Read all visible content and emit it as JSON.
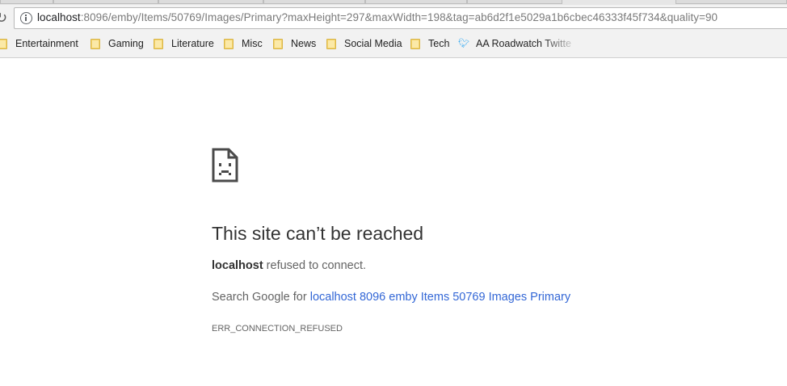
{
  "browser": {
    "url_host": "localhost",
    "url_rest": ":8096/emby/Items/50769/Images/Primary?maxHeight=297&maxWidth=198&tag=ab6d2f1e5029a1b6cbec46333f45f734&quality=90",
    "icons": {
      "reload": "reload-icon",
      "site_info": "info-icon",
      "folder": "folder-icon",
      "twitter": "twitter-icon"
    }
  },
  "bookmarks": [
    {
      "label": "Entertainment",
      "icon": "folder-icon"
    },
    {
      "label": "Gaming",
      "icon": "folder-icon"
    },
    {
      "label": "Literature",
      "icon": "folder-icon"
    },
    {
      "label": "Misc",
      "icon": "folder-icon"
    },
    {
      "label": "News",
      "icon": "folder-icon"
    },
    {
      "label": "Social Media",
      "icon": "folder-icon"
    },
    {
      "label": "Tech",
      "icon": "folder-icon"
    },
    {
      "label": "AA Roadwatch Twitte",
      "icon": "twitter-icon"
    }
  ],
  "error": {
    "icon": "sad-page-icon",
    "title": "This site can’t be reached",
    "host": "localhost",
    "refused_text": " refused to connect.",
    "search_prefix": "Search Google for ",
    "search_link": "localhost 8096 emby Items 50769 Images Primary",
    "code": "ERR_CONNECTION_REFUSED"
  },
  "colors": {
    "link": "#3367d6",
    "title_text": "#333333",
    "body_text": "#646464",
    "bookmark_folder": "#f4d36b"
  }
}
